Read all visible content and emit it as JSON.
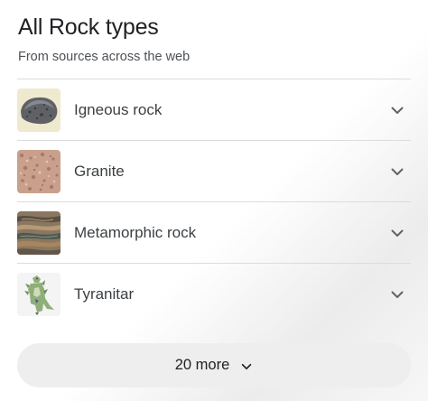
{
  "header": {
    "title": "All Rock types",
    "subtitle": "From sources across the web"
  },
  "items": [
    {
      "label": "Igneous rock",
      "icon": "igneous-rock-thumbnail"
    },
    {
      "label": "Granite",
      "icon": "granite-thumbnail"
    },
    {
      "label": "Metamorphic rock",
      "icon": "metamorphic-rock-thumbnail"
    },
    {
      "label": "Tyranitar",
      "icon": "tyranitar-thumbnail"
    }
  ],
  "more_button": {
    "label": "20 more",
    "icon": "chevron-down-icon"
  }
}
